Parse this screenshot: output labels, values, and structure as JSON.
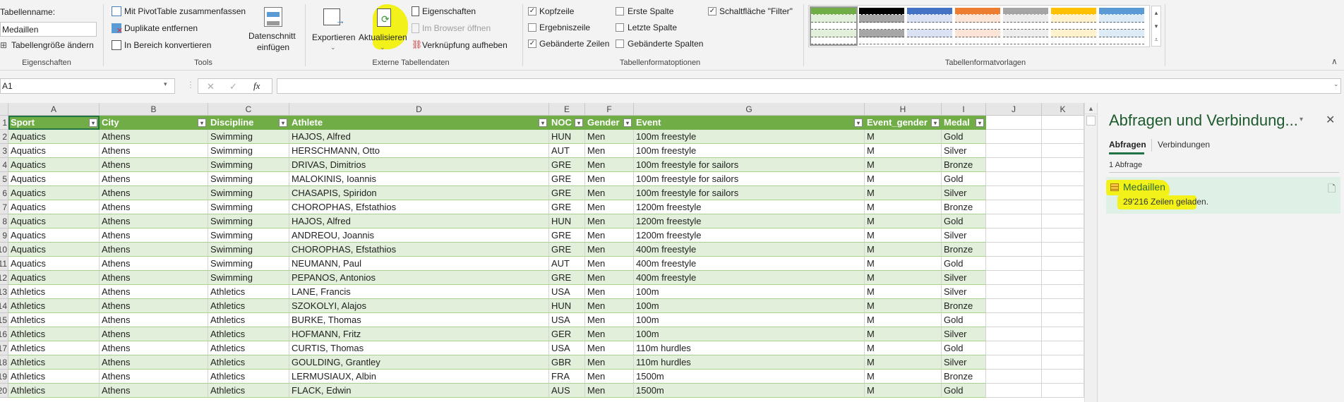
{
  "ribbon": {
    "eigenschaften": {
      "table_name_label": "Tabellenname:",
      "table_name_value": "Medaillen",
      "resize": "Tabellengröße ändern",
      "group": "Eigenschaften"
    },
    "tools": {
      "pivot": "Mit PivotTable zusammenfassen",
      "duplicates": "Duplikate entfernen",
      "convert": "In Bereich konvertieren",
      "slicer_line1": "Datenschnitt",
      "slicer_line2": "einfügen",
      "group": "Tools"
    },
    "external": {
      "export": "Exportieren",
      "refresh": "Aktualisieren",
      "properties": "Eigenschaften",
      "open_browser": "Im Browser öffnen",
      "unlink": "Verknüpfung aufheben",
      "group": "Externe Tabellendaten"
    },
    "options": {
      "header_row": "Kopfzeile",
      "total_row": "Ergebniszeile",
      "banded_rows": "Gebänderte Zeilen",
      "first_col": "Erste Spalte",
      "last_col": "Letzte Spalte",
      "banded_cols": "Gebänderte Spalten",
      "filter_button": "Schaltfläche \"Filter\"",
      "checked": {
        "header_row": true,
        "total_row": false,
        "banded_rows": true,
        "first_col": false,
        "last_col": false,
        "banded_cols": false,
        "filter_button": true
      },
      "group": "Tabellenformatoptionen"
    },
    "styles": {
      "group": "Tabellenformatvorlagen",
      "swatches": [
        [
          "#70ad47",
          "#e2efda"
        ],
        [
          "#000000",
          "#a6a6a6"
        ],
        [
          "#4472c4",
          "#d9e1f2"
        ],
        [
          "#ed7d31",
          "#fce4d6"
        ],
        [
          "#a5a5a5",
          "#ededed"
        ],
        [
          "#ffc000",
          "#fff2cc"
        ],
        [
          "#5b9bd5",
          "#ddebf7"
        ]
      ]
    }
  },
  "formula_bar": {
    "name_box": "A1",
    "formula": "",
    "fx": "fx"
  },
  "sheet": {
    "column_letters": [
      "A",
      "B",
      "C",
      "D",
      "E",
      "F",
      "G",
      "H",
      "I",
      "J",
      "K"
    ],
    "headers": [
      "Sport",
      "City",
      "Discipline",
      "Athlete",
      "NOC",
      "Gender",
      "Event",
      "Event_gender",
      "Medal"
    ],
    "row_numbers": [
      "1",
      "2",
      "3",
      "4",
      "5",
      "6",
      "7",
      "8",
      "9",
      "10",
      "11",
      "12",
      "13",
      "14",
      "15",
      "16",
      "17",
      "18",
      "19",
      "20"
    ],
    "rows": [
      [
        "Aquatics",
        "Athens",
        "Swimming",
        "HAJOS, Alfred",
        "HUN",
        "Men",
        "100m freestyle",
        "M",
        "Gold"
      ],
      [
        "Aquatics",
        "Athens",
        "Swimming",
        "HERSCHMANN, Otto",
        "AUT",
        "Men",
        "100m freestyle",
        "M",
        "Silver"
      ],
      [
        "Aquatics",
        "Athens",
        "Swimming",
        "DRIVAS, Dimitrios",
        "GRE",
        "Men",
        "100m freestyle for sailors",
        "M",
        "Bronze"
      ],
      [
        "Aquatics",
        "Athens",
        "Swimming",
        "MALOKINIS, Ioannis",
        "GRE",
        "Men",
        "100m freestyle for sailors",
        "M",
        "Gold"
      ],
      [
        "Aquatics",
        "Athens",
        "Swimming",
        "CHASAPIS, Spiridon",
        "GRE",
        "Men",
        "100m freestyle for sailors",
        "M",
        "Silver"
      ],
      [
        "Aquatics",
        "Athens",
        "Swimming",
        "CHOROPHAS, Efstathios",
        "GRE",
        "Men",
        "1200m freestyle",
        "M",
        "Bronze"
      ],
      [
        "Aquatics",
        "Athens",
        "Swimming",
        "HAJOS, Alfred",
        "HUN",
        "Men",
        "1200m freestyle",
        "M",
        "Gold"
      ],
      [
        "Aquatics",
        "Athens",
        "Swimming",
        "ANDREOU, Joannis",
        "GRE",
        "Men",
        "1200m freestyle",
        "M",
        "Silver"
      ],
      [
        "Aquatics",
        "Athens",
        "Swimming",
        "CHOROPHAS, Efstathios",
        "GRE",
        "Men",
        "400m freestyle",
        "M",
        "Bronze"
      ],
      [
        "Aquatics",
        "Athens",
        "Swimming",
        "NEUMANN, Paul",
        "AUT",
        "Men",
        "400m freestyle",
        "M",
        "Gold"
      ],
      [
        "Aquatics",
        "Athens",
        "Swimming",
        "PEPANOS, Antonios",
        "GRE",
        "Men",
        "400m freestyle",
        "M",
        "Silver"
      ],
      [
        "Athletics",
        "Athens",
        "Athletics",
        "LANE, Francis",
        "USA",
        "Men",
        "100m",
        "M",
        "Silver"
      ],
      [
        "Athletics",
        "Athens",
        "Athletics",
        "SZOKOLYI, Alajos",
        "HUN",
        "Men",
        "100m",
        "M",
        "Bronze"
      ],
      [
        "Athletics",
        "Athens",
        "Athletics",
        "BURKE, Thomas",
        "USA",
        "Men",
        "100m",
        "M",
        "Gold"
      ],
      [
        "Athletics",
        "Athens",
        "Athletics",
        "HOFMANN, Fritz",
        "GER",
        "Men",
        "100m",
        "M",
        "Silver"
      ],
      [
        "Athletics",
        "Athens",
        "Athletics",
        "CURTIS, Thomas",
        "USA",
        "Men",
        "110m hurdles",
        "M",
        "Gold"
      ],
      [
        "Athletics",
        "Athens",
        "Athletics",
        "GOULDING, Grantley",
        "GBR",
        "Men",
        "110m hurdles",
        "M",
        "Silver"
      ],
      [
        "Athletics",
        "Athens",
        "Athletics",
        "LERMUSIAUX, Albin",
        "FRA",
        "Men",
        "1500m",
        "M",
        "Bronze"
      ],
      [
        "Athletics",
        "Athens",
        "Athletics",
        "FLACK, Edwin",
        "AUS",
        "Men",
        "1500m",
        "M",
        "Gold"
      ]
    ]
  },
  "pane": {
    "title": "Abfragen und Verbindung...",
    "tab_queries": "Abfragen",
    "tab_connections": "Verbindungen",
    "count": "1 Abfrage",
    "query_name": "Medaillen",
    "query_status": "29'216 Zeilen geladen."
  },
  "colors": {
    "header": "#70ad47",
    "band": "#e2efda",
    "highlight": "#f2f21a"
  }
}
